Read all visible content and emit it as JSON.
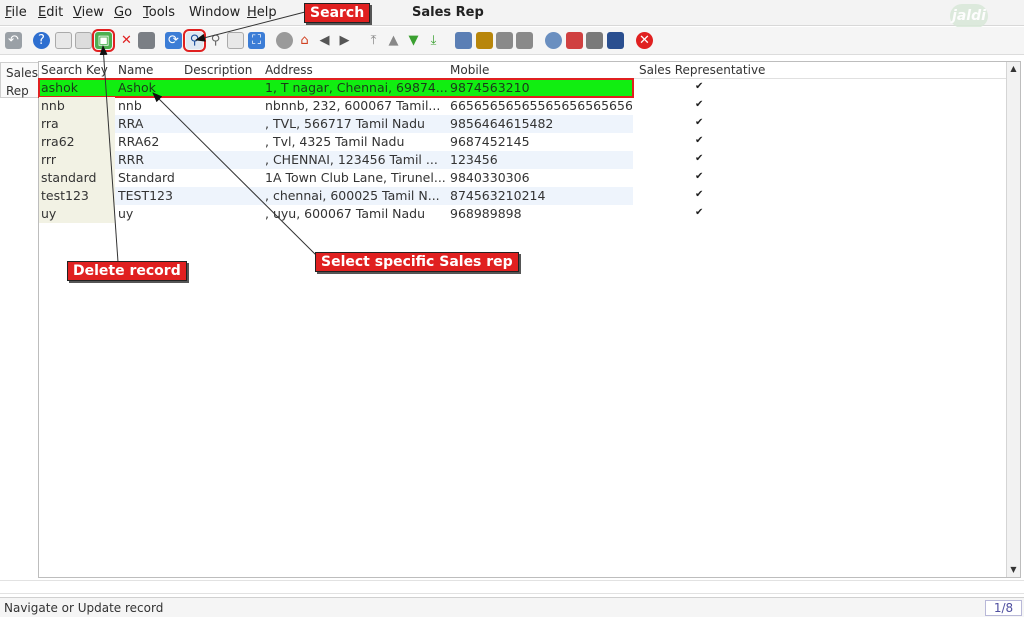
{
  "menu": {
    "file": {
      "key": "F",
      "rest": "ile"
    },
    "edit": {
      "key": "E",
      "rest": "dit"
    },
    "view": {
      "key": "V",
      "rest": "iew"
    },
    "go": {
      "key": "G",
      "rest": "o"
    },
    "tools": {
      "key": "T",
      "rest": "ools"
    },
    "window": "Window",
    "help": {
      "key": "H",
      "rest": "elp"
    }
  },
  "window_title": "Sales Rep",
  "logo_text": "jaldi",
  "left_tab": {
    "line1": "Sales",
    "line2": "Rep"
  },
  "grid": {
    "columns": [
      "Search Key",
      "Name",
      "Description",
      "Address",
      "Mobile",
      "Sales Representative"
    ],
    "rows": [
      {
        "key": "ashok",
        "name": "Ashok",
        "description": "",
        "address": "1, T nagar, Chennai,  69874...",
        "mobile": "9874563210",
        "sales_rep": true
      },
      {
        "key": "nnb",
        "name": "nnb",
        "description": "",
        "address": "nbnnb, 232,  600067 Tamil...",
        "mobile": "6656565656556565656565656...",
        "sales_rep": true
      },
      {
        "key": "rra",
        "name": "RRA",
        "description": "",
        "address": ", TVL,  566717 Tamil Nadu",
        "mobile": "9856464615482",
        "sales_rep": true
      },
      {
        "key": "rra62",
        "name": "RRA62",
        "description": "",
        "address": ", Tvl,  4325 Tamil Nadu",
        "mobile": "9687452145",
        "sales_rep": true
      },
      {
        "key": "rrr",
        "name": "RRR",
        "description": "",
        "address": ", CHENNAI,  123456 Tamil ...",
        "mobile": "123456",
        "sales_rep": true
      },
      {
        "key": "standard",
        "name": "Standard",
        "description": "",
        "address": "1A Town Club Lane, Tirunel...",
        "mobile": "9840330306",
        "sales_rep": true
      },
      {
        "key": "test123",
        "name": "TEST123",
        "description": "",
        "address": ", chennai,  600025 Tamil N...",
        "mobile": "874563210214",
        "sales_rep": true
      },
      {
        "key": "uy",
        "name": "uy",
        "description": "",
        "address": ", uyu,  600067 Tamil Nadu",
        "mobile": "968989898",
        "sales_rep": true
      }
    ]
  },
  "status": {
    "message": "Navigate or Update record",
    "record_count": "1/8"
  },
  "annotations": {
    "search": "Search",
    "delete_record": "Delete record",
    "select_rep": "Select specific Sales rep"
  },
  "colors": {
    "selected_row": "#11ee11",
    "callout": "#e02020",
    "alt_row": "#eef4fc"
  }
}
